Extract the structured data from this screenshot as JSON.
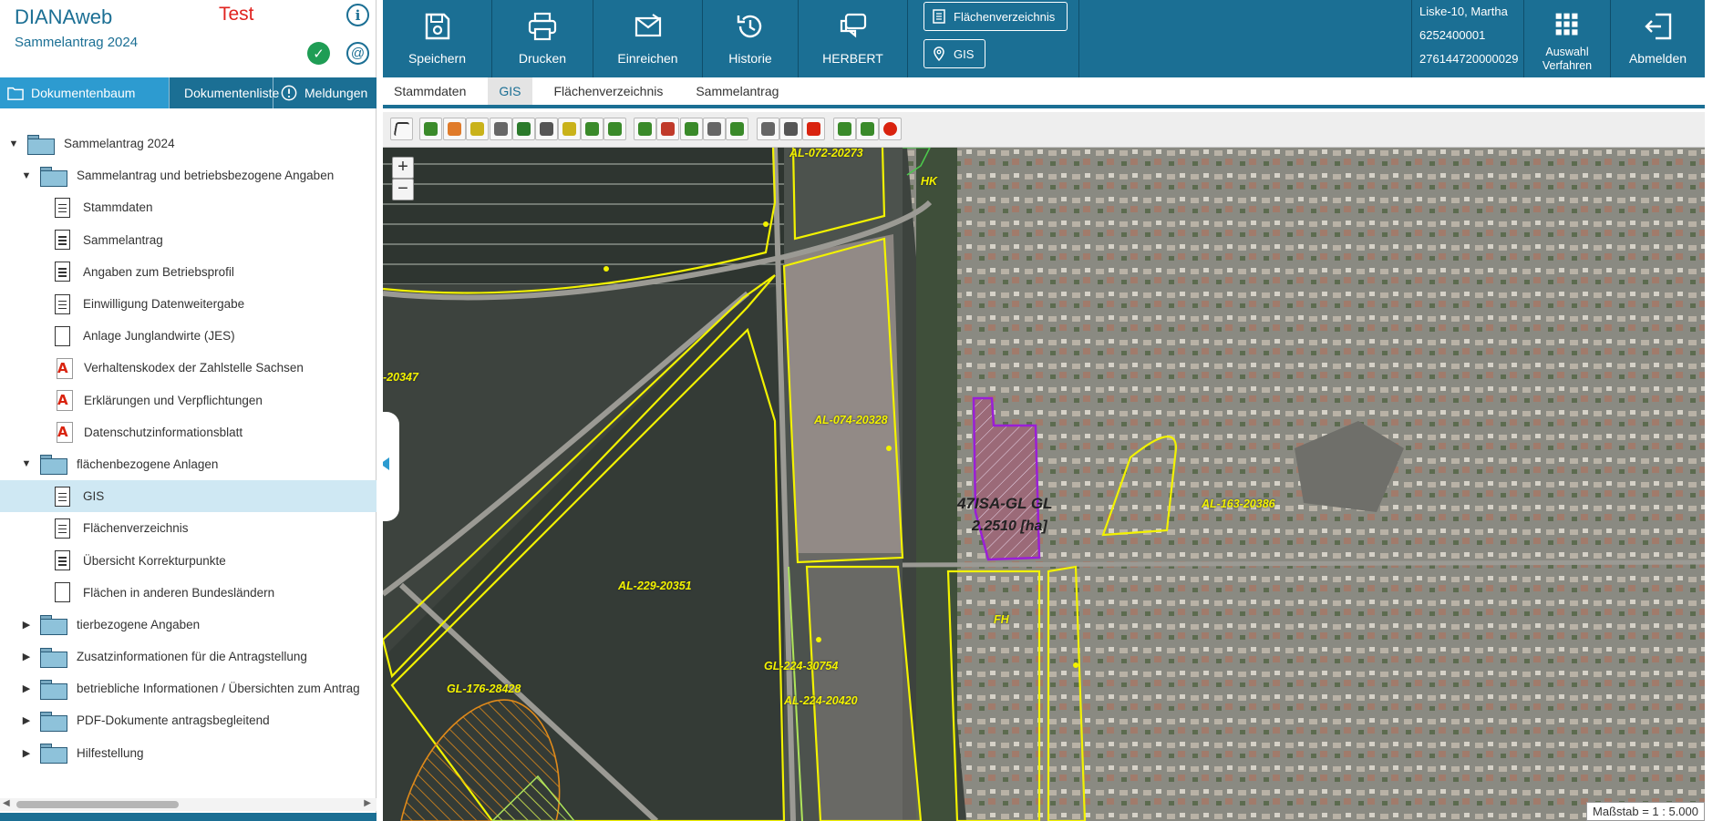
{
  "brand": {
    "app_name": "DIANAweb",
    "subtitle": "Sammelantrag 2024",
    "env": "Test",
    "ok_glyph": "✓",
    "mail_glyph": "@",
    "info_glyph": "i"
  },
  "left_tabs": [
    {
      "label": "Dokumentenbaum",
      "icon": "folder-icon"
    },
    {
      "label": "Dokumentenliste",
      "icon": "list-icon"
    },
    {
      "label": "Meldungen",
      "icon": "warning-icon"
    }
  ],
  "tree": [
    {
      "label": "Sammelantrag 2024",
      "level": 0,
      "type": "folder",
      "state": "expanded"
    },
    {
      "label": "Sammelantrag und betriebsbezogene Angaben",
      "level": 1,
      "type": "folder",
      "state": "expanded"
    },
    {
      "label": "Stammdaten",
      "level": 2,
      "type": "doc-lines"
    },
    {
      "label": "Sammelantrag",
      "level": 2,
      "type": "doc-lines"
    },
    {
      "label": "Angaben zum Betriebsprofil",
      "level": 2,
      "type": "doc-lines"
    },
    {
      "label": "Einwilligung Datenweitergabe",
      "level": 2,
      "type": "doc-lines"
    },
    {
      "label": "Anlage Junglandwirte (JES)",
      "level": 2,
      "type": "doc"
    },
    {
      "label": "Verhaltenskodex der Zahlstelle Sachsen",
      "level": 2,
      "type": "pdf"
    },
    {
      "label": "Erklärungen und Verpflichtungen",
      "level": 2,
      "type": "pdf"
    },
    {
      "label": "Datenschutzinformationsblatt",
      "level": 2,
      "type": "pdf"
    },
    {
      "label": "flächenbezogene Anlagen",
      "level": 1,
      "type": "folder",
      "state": "expanded"
    },
    {
      "label": "GIS",
      "level": 2,
      "type": "doc-lines",
      "selected": true
    },
    {
      "label": "Flächenverzeichnis",
      "level": 2,
      "type": "doc-lines"
    },
    {
      "label": "Übersicht Korrekturpunkte",
      "level": 2,
      "type": "doc-lines"
    },
    {
      "label": "Flächen in anderen Bundesländern",
      "level": 2,
      "type": "doc"
    },
    {
      "label": "tierbezogene Angaben",
      "level": 0,
      "type": "folder",
      "state": "collapsed"
    },
    {
      "label": "Zusatzinformationen für die Antragstellung",
      "level": 0,
      "type": "folder",
      "state": "collapsed"
    },
    {
      "label": "betriebliche Informationen / Übersichten zum Antrag",
      "level": 0,
      "type": "folder",
      "state": "collapsed"
    },
    {
      "label": "PDF-Dokumente antragsbegleitend",
      "level": 0,
      "type": "folder",
      "state": "collapsed"
    },
    {
      "label": "Hilfestellung",
      "level": 0,
      "type": "folder",
      "state": "collapsed"
    }
  ],
  "toolbar": {
    "save": "Speichern",
    "print": "Drucken",
    "submit": "Einreichen",
    "history": "Historie",
    "herbert": "HERBERT",
    "flaechen_pill": "Flächenverzeichnis",
    "gis_pill": "GIS",
    "select_proc": "Auswahl Verfahren",
    "logout": "Abmelden"
  },
  "user": {
    "name": "Liske-10, Martha",
    "id1": "6252400001",
    "id2": "276144720000029"
  },
  "sub_tabs": [
    {
      "label": "Stammdaten",
      "active": false
    },
    {
      "label": "GIS",
      "active": true
    },
    {
      "label": "Flächenverzeichnis",
      "active": false
    },
    {
      "label": "Sammelantrag",
      "active": false
    }
  ],
  "gis_tools": [
    {
      "name": "select-tool-icon",
      "color": "#ffffff"
    },
    {
      "name": "draw-polygon-icon",
      "color": "#3a8a2a"
    },
    {
      "name": "edit-pencil-icon",
      "color": "#e07b2a"
    },
    {
      "name": "edit-vertex-icon",
      "color": "#c9b21a"
    },
    {
      "name": "cut-icon",
      "color": "#666666"
    },
    {
      "name": "merge-icon",
      "color": "#2b7a2b"
    },
    {
      "name": "delete-icon",
      "color": "#555555"
    },
    {
      "name": "measure-icon",
      "color": "#c9b21a"
    },
    {
      "name": "split-icon",
      "color": "#3a8a2a"
    },
    {
      "name": "move-icon",
      "color": "#3a8a2a"
    },
    {
      "name": "layer-add-icon",
      "color": "#3a8a2a"
    },
    {
      "name": "layer-remove-icon",
      "color": "#c03a2a"
    },
    {
      "name": "layer-stack-icon",
      "color": "#3a8a2a"
    },
    {
      "name": "ruler-icon",
      "color": "#666666"
    },
    {
      "name": "area-icon",
      "color": "#3a8a2a"
    },
    {
      "name": "locate-icon",
      "color": "#666666"
    },
    {
      "name": "legend-icon",
      "color": "#555555"
    },
    {
      "name": "snap-magnet-icon",
      "color": "#d9230f"
    },
    {
      "name": "undo-icon",
      "color": "#3a8a2a"
    },
    {
      "name": "redo-icon",
      "color": "#3a8a2a"
    },
    {
      "name": "cancel-icon",
      "color": "#d9230f"
    }
  ],
  "map": {
    "zoom_in": "+",
    "zoom_out": "−",
    "scale": "Maßstab = 1 : 5.000",
    "parcel_text": "47ISA-GL GL",
    "parcel_area": "2.2510 [ha]",
    "field_labels": [
      "AL-072-20273",
      "-20347",
      "AL-074-20328",
      "AL-163-20386",
      "AL-229-20351",
      "FH",
      "GL-224-30754",
      "GL-176-28428",
      "AL-224-20420",
      "HK"
    ]
  },
  "colors": {
    "brand": "#1b6f94",
    "active_tab": "#2d9bd0",
    "field_outline": "#f2f200",
    "parcel": "#9a1fd6"
  }
}
